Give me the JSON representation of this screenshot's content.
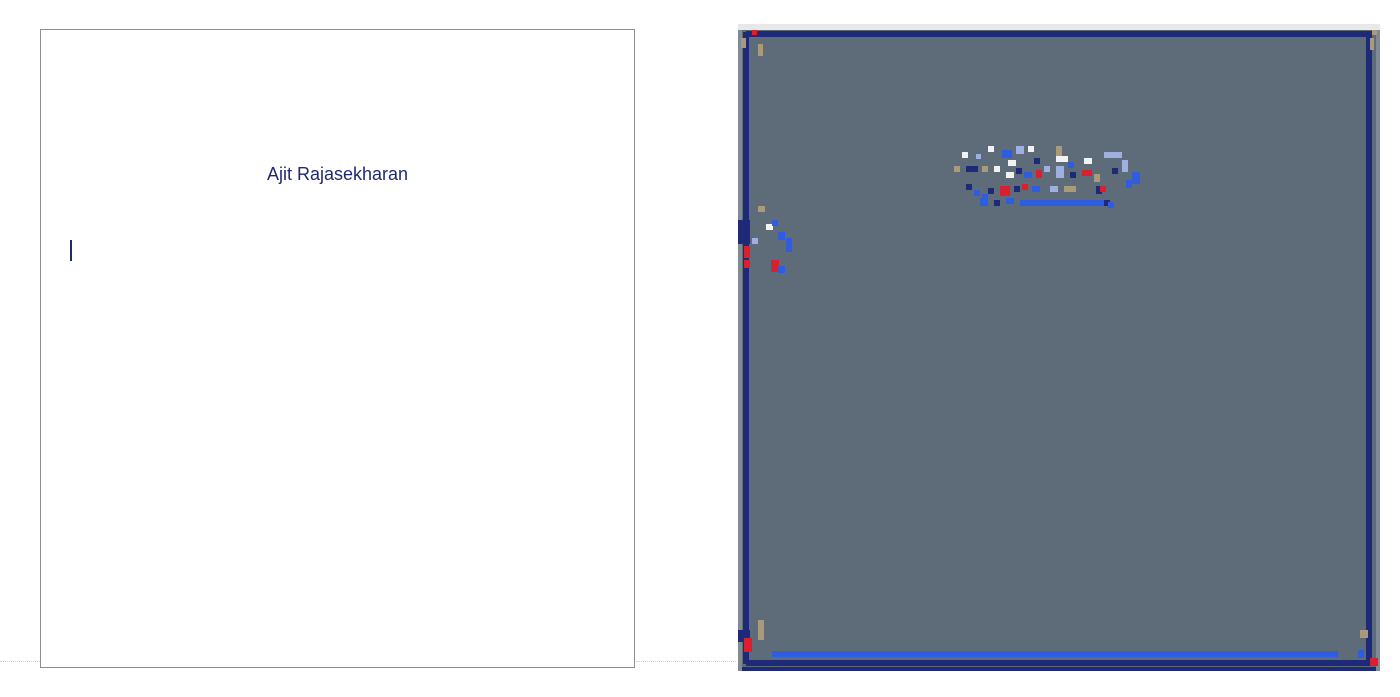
{
  "document": {
    "heading": "Ajit Rajasekharan"
  },
  "colors": {
    "page_background": "#ffffff",
    "page_border": "#8a8f8a",
    "heading_text": "#1f2a6e",
    "render_background": "#5e6b79",
    "render_border_dark": "#1e2a78",
    "render_accent_blue": "#2f5de0",
    "render_accent_red": "#d8202f",
    "render_accent_tan": "#a89a7a",
    "render_accent_white": "#f2f2f2"
  }
}
